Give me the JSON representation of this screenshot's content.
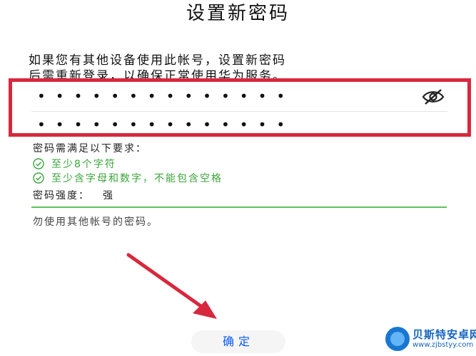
{
  "page": {
    "title": "设置新密码",
    "description_line1": "如果您有其他设备使用此帐号，设置新密码",
    "description_line2": "后需重新登录，以确保正常使用华为服务。"
  },
  "form": {
    "new_password_value": "••••••••••••••",
    "confirm_password_value": "••••••••••••••"
  },
  "requirements": {
    "title": "密码需满足以下要求：",
    "items": [
      {
        "label": "至少8个字符",
        "met": true
      },
      {
        "label": "至少含字母和数字，不能包含空格",
        "met": true
      }
    ]
  },
  "strength": {
    "label": "密码强度：",
    "value": "强"
  },
  "hint": "勿使用其他帐号的密码。",
  "confirm_button": {
    "label": "确定"
  },
  "colors": {
    "accent": "#0a59f7",
    "success": "#3aa53a",
    "highlight": "#d8283d"
  },
  "watermark": {
    "name": "贝斯特安卓网",
    "url": "www.zjbstyy.com"
  }
}
